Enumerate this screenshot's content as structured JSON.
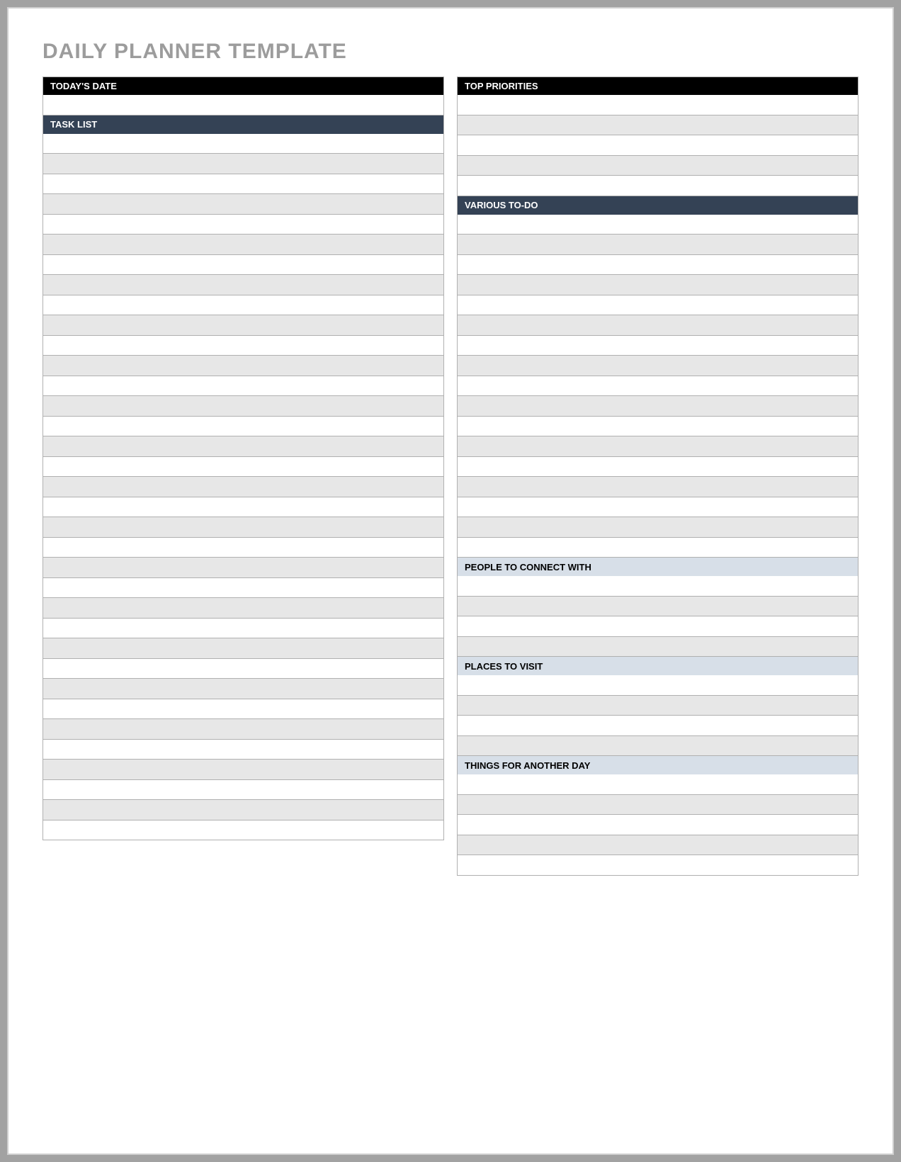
{
  "title": "DAILY PLANNER TEMPLATE",
  "left": {
    "todays_date": {
      "label": "TODAY'S DATE",
      "rows": 1
    },
    "task_list": {
      "label": "TASK LIST",
      "rows": 35
    }
  },
  "right": {
    "top_priorities": {
      "label": "TOP PRIORITIES",
      "rows": 5
    },
    "various_todo": {
      "label": "VARIOUS TO-DO",
      "rows": 17
    },
    "people_to_connect_with": {
      "label": "PEOPLE TO CONNECT WITH",
      "rows": 4
    },
    "places_to_visit": {
      "label": "PLACES TO VISIT",
      "rows": 4
    },
    "things_for_another_day": {
      "label": "THINGS FOR ANOTHER DAY",
      "rows": 5
    }
  }
}
